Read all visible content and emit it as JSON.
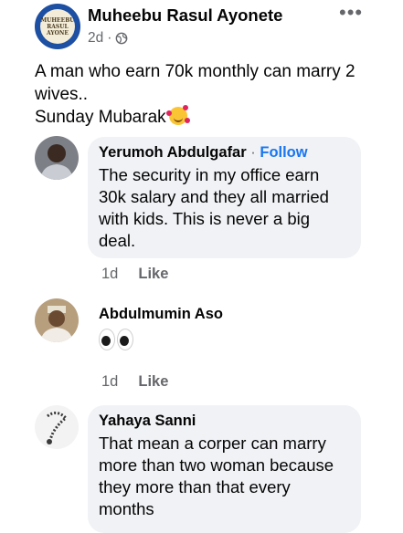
{
  "post": {
    "author": "Muheebu Rasul Ayonete",
    "time": "2d",
    "privacy_icon": "globe-icon",
    "more_label": "•••",
    "avatar_text": [
      "MUHEEBU",
      "RASUL",
      "AYONE"
    ],
    "text_lines": [
      "A man who earn 70k monthly can marry 2",
      "wives..",
      "Sunday Mubarak"
    ],
    "emoji": "smiling-face-with-hearts"
  },
  "comments": [
    {
      "name": "Yerumoh Abdulgafar",
      "separator": "·",
      "follow_label": "Follow",
      "text_lines": [
        "The security in my office earn",
        "30k salary and they all married",
        "with kids. This is never a big",
        "deal."
      ],
      "time": "1d",
      "like_label": "Like"
    },
    {
      "name": "Abdulmumin Aso",
      "emoji": "eyes",
      "time": "1d",
      "like_label": "Like"
    },
    {
      "name": "Yahaya Sanni",
      "text_lines": [
        "That mean a corper can marry",
        "more than two woman because",
        "they more than that every",
        "months"
      ]
    }
  ]
}
